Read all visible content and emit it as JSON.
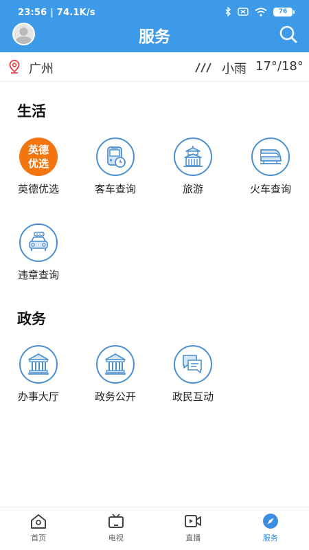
{
  "status_bar": {
    "time": "23:56",
    "speed": "74.1K/s",
    "battery": "76"
  },
  "header": {
    "title": "服务"
  },
  "location": {
    "city": "广州"
  },
  "weather": {
    "desc": "小雨",
    "temp": "17°/18°"
  },
  "sections": [
    {
      "title": "生活",
      "items": [
        {
          "label": "英德优选",
          "icon": "yingde-logo-icon",
          "logo_text": [
            "英德",
            "优选"
          ]
        },
        {
          "label": "客车查询",
          "icon": "bus-clock-icon"
        },
        {
          "label": "旅游",
          "icon": "temple-icon"
        },
        {
          "label": "火车查询",
          "icon": "train-icon"
        },
        {
          "label": "违章查询",
          "icon": "car-icon"
        }
      ]
    },
    {
      "title": "政务",
      "items": [
        {
          "label": "办事大厅",
          "icon": "government-building-icon"
        },
        {
          "label": "政务公开",
          "icon": "government-building-icon"
        },
        {
          "label": "政民互动",
          "icon": "chat-bubbles-icon"
        }
      ]
    }
  ],
  "tabs": [
    {
      "label": "首页",
      "icon": "home-icon",
      "active": false
    },
    {
      "label": "电视",
      "icon": "tv-icon",
      "active": false
    },
    {
      "label": "直播",
      "icon": "video-icon",
      "active": false
    },
    {
      "label": "服务",
      "icon": "compass-icon",
      "active": true
    }
  ],
  "colors": {
    "header": "#3d9ae8",
    "icon_ring": "#4a8fd0",
    "brand_orange": "#f2750f",
    "active_tab": "#3d8de0"
  }
}
